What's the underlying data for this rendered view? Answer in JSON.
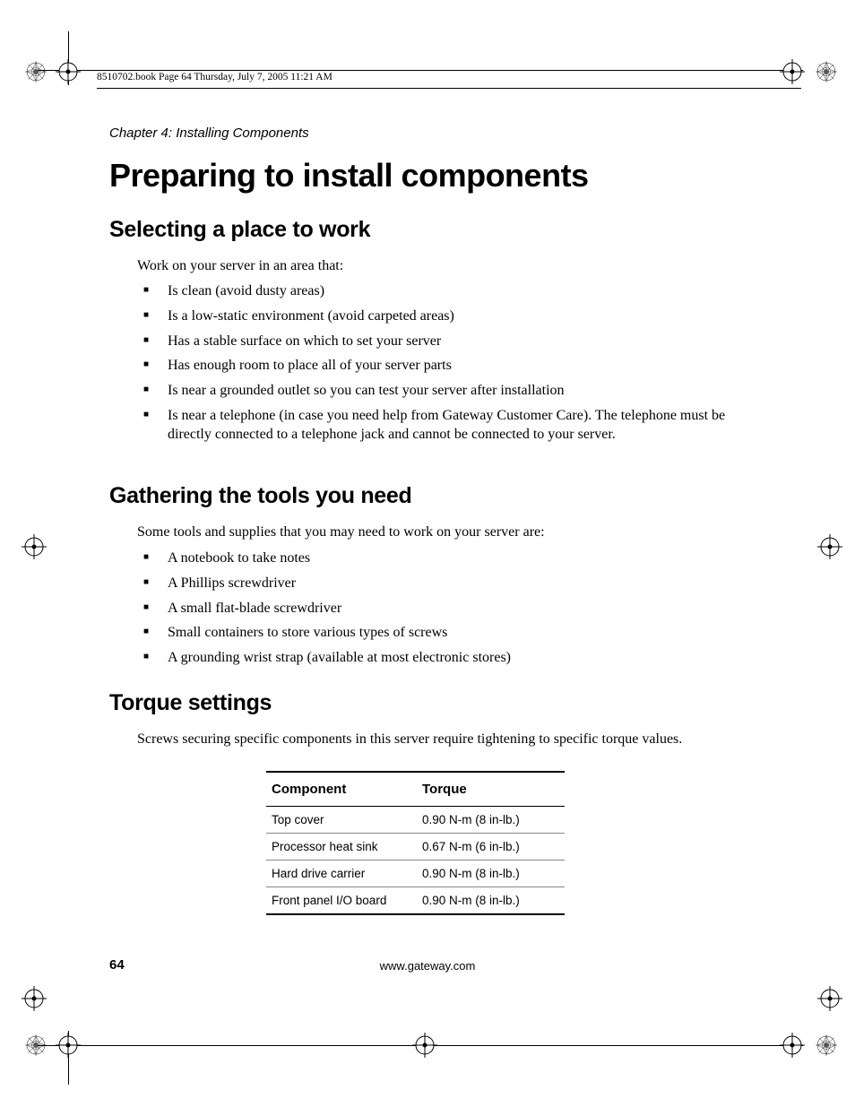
{
  "header_text": "8510702.book  Page 64  Thursday, July 7, 2005  11:21 AM",
  "chapter_label": "Chapter 4: Installing Components",
  "page_title": "Preparing to install components",
  "section1": {
    "heading": "Selecting a place to work",
    "intro": "Work on your server in an area that:",
    "bullets": [
      "Is clean (avoid dusty areas)",
      "Is a low-static environment (avoid carpeted areas)",
      "Has a stable surface on which to set your server",
      "Has enough room to place all of your server parts",
      "Is near a grounded outlet so you can test your server after installation",
      "Is near a telephone (in case you need help from Gateway Customer Care). The telephone must be directly connected to a telephone jack and cannot be connected to your server."
    ]
  },
  "section2": {
    "heading": "Gathering the tools you need",
    "intro": "Some tools and supplies that you may need to work on your server are:",
    "bullets": [
      "A notebook to take notes",
      "A Phillips screwdriver",
      "A small flat-blade screwdriver",
      "Small containers to store various types of screws",
      "A grounding wrist strap (available at most electronic stores)"
    ]
  },
  "section3": {
    "heading": "Torque settings",
    "intro": "Screws securing specific components in this server require tightening to specific torque values.",
    "table": {
      "headers": [
        "Component",
        "Torque"
      ],
      "rows": [
        [
          "Top cover",
          "0.90 N-m (8 in-lb.)"
        ],
        [
          "Processor heat sink",
          "0.67 N-m (6 in-lb.)"
        ],
        [
          "Hard drive carrier",
          "0.90 N-m (8 in-lb.)"
        ],
        [
          "Front panel I/O board",
          "0.90 N-m (8 in-lb.)"
        ]
      ]
    }
  },
  "page_number": "64",
  "footer_url": "www.gateway.com"
}
